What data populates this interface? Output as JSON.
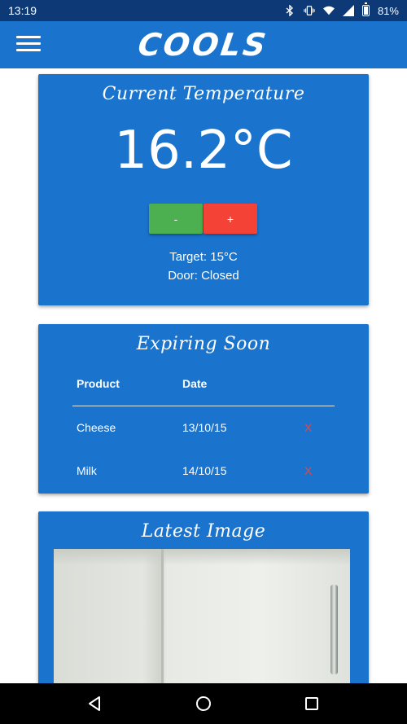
{
  "status_bar": {
    "time": "13:19",
    "battery": "81%",
    "icons": [
      "bluetooth-icon",
      "vibrate-icon",
      "wifi-icon",
      "signal-icon",
      "battery-icon"
    ]
  },
  "app_bar": {
    "title": "COOLS",
    "menu_icon": "hamburger-menu-icon"
  },
  "temperature_card": {
    "title": "Current Temperature",
    "value": "16.2°C",
    "minus_label": "-",
    "plus_label": "+",
    "target": "Target: 15°C",
    "door": "Door: Closed"
  },
  "expiring_card": {
    "title": "Expiring Soon",
    "columns": [
      "Product",
      "Date"
    ],
    "rows": [
      {
        "product": "Cheese",
        "date": "13/10/15",
        "delete": "X"
      },
      {
        "product": "Milk",
        "date": "14/10/15",
        "delete": "X"
      }
    ]
  },
  "image_card": {
    "title": "Latest Image"
  },
  "nav_bar": {
    "icons": [
      "back-icon",
      "home-icon",
      "recents-icon"
    ]
  },
  "colors": {
    "status_bar": "#0d3a77",
    "app_bar": "#1a73cd",
    "card": "#1a73cd",
    "minus_button": "#4caf50",
    "plus_button": "#f44336",
    "delete": "#f44336"
  }
}
